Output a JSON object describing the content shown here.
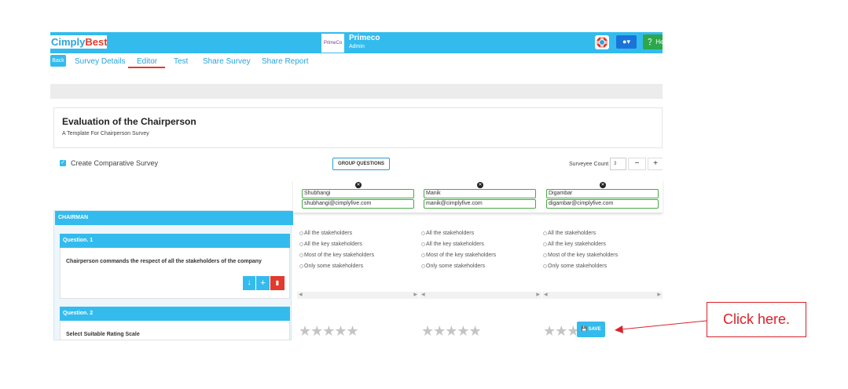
{
  "brand": {
    "logo_part1": "Cimply",
    "logo_part2": "Best"
  },
  "org": {
    "logo_text": "PrimeCo",
    "name": "Primeco",
    "role": "Admin"
  },
  "header": {
    "help_label": "He"
  },
  "nav": {
    "back": "Back",
    "tabs": [
      "Survey Details",
      "Editor",
      "Test",
      "Share Survey",
      "Share Report"
    ],
    "active_tab": "Editor"
  },
  "survey": {
    "title": "Evaluation of the Chairperson",
    "subtitle": "A Template For Chairperson Survey"
  },
  "options": {
    "comparative_label": "Create Comparative Survey",
    "comparative_checked": true,
    "group_questions": "GROUP QUESTIONS",
    "surveyee_count_label": "Surveyee Count",
    "surveyee_count": "3",
    "minus": "−",
    "plus": "+"
  },
  "surveyees": [
    {
      "name": "Shubhangi",
      "email": "shubhangi@cimplyfive.com"
    },
    {
      "name": "Manik",
      "email": "manik@cimplyfive.com"
    },
    {
      "name": "Digambar",
      "email": "digambar@cimplyfive.com"
    }
  ],
  "section": {
    "title": "CHAIRMAN"
  },
  "questions": [
    {
      "label": "Question. 1",
      "text": "Chairperson commands the respect of all the stakeholders of the company"
    },
    {
      "label": "Question. 2",
      "text": "Select Suitable Rating Scale"
    }
  ],
  "answer_options": [
    "All the stakeholders",
    "All the key stakeholders",
    "Most of the key stakeholders",
    "Only some stakeholders"
  ],
  "stars": "★★★★★",
  "stars_partial": "★★★",
  "save_label": "SAVE",
  "annotation": {
    "text": "Click here."
  },
  "colors": {
    "accent": "#33bbee",
    "brand_red": "#e23a2c",
    "callout": "#d9222a",
    "valid": "#4aa84a"
  }
}
